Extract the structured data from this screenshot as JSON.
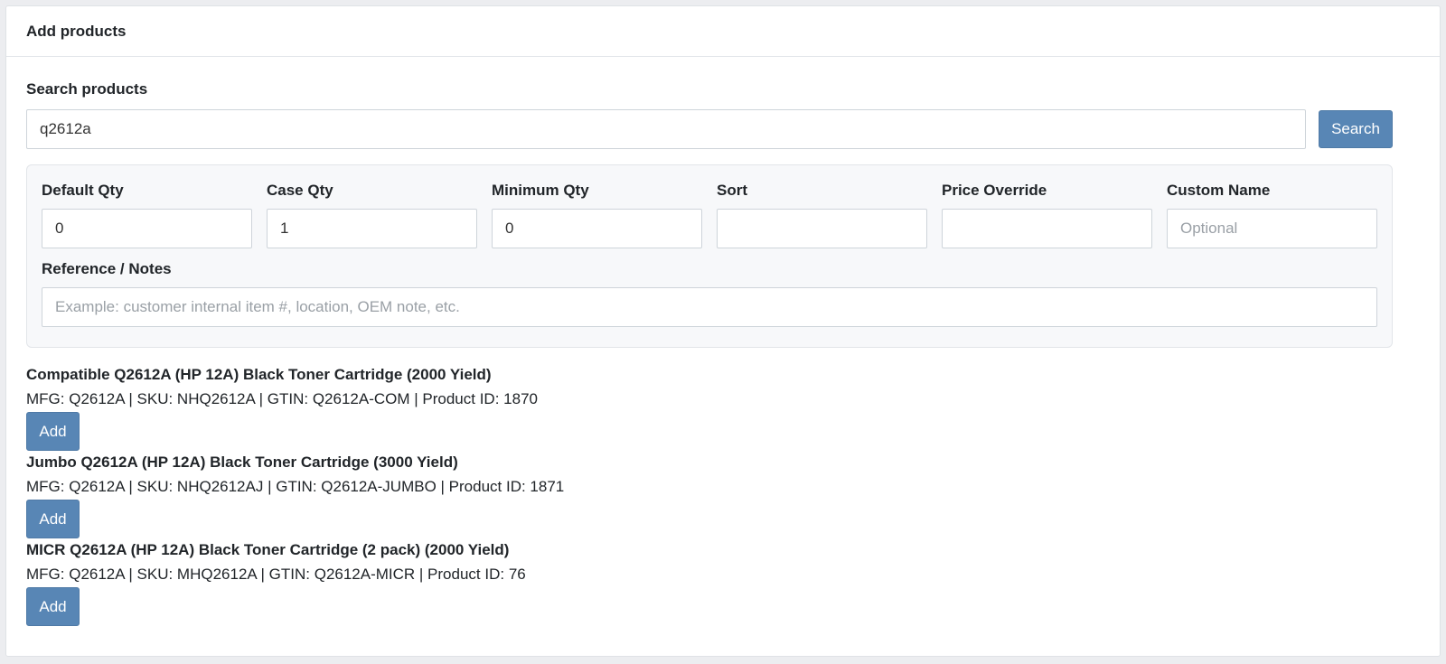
{
  "header": {
    "title": "Add products"
  },
  "search": {
    "label": "Search products",
    "value": "q2612a",
    "button_label": "Search"
  },
  "options": {
    "default_qty": {
      "label": "Default Qty",
      "value": "0",
      "placeholder": ""
    },
    "case_qty": {
      "label": "Case Qty",
      "value": "1",
      "placeholder": ""
    },
    "minimum_qty": {
      "label": "Minimum Qty",
      "value": "0",
      "placeholder": ""
    },
    "sort": {
      "label": "Sort",
      "value": "",
      "placeholder": ""
    },
    "price_override": {
      "label": "Price Override",
      "value": "",
      "placeholder": ""
    },
    "custom_name": {
      "label": "Custom Name",
      "value": "",
      "placeholder": "Optional"
    },
    "notes": {
      "label": "Reference / Notes",
      "value": "",
      "placeholder": "Example: customer internal item #, location, OEM note, etc."
    }
  },
  "results": [
    {
      "name": "Compatible Q2612A (HP 12A) Black Toner Cartridge (2000 Yield)",
      "meta": "MFG: Q2612A | SKU: NHQ2612A | GTIN: Q2612A-COM | Product ID: 1870",
      "add_label": "Add"
    },
    {
      "name": "Jumbo Q2612A (HP 12A) Black Toner Cartridge (3000 Yield)",
      "meta": "MFG: Q2612A | SKU: NHQ2612AJ | GTIN: Q2612A-JUMBO | Product ID: 1871",
      "add_label": "Add"
    },
    {
      "name": "MICR Q2612A (HP 12A) Black Toner Cartridge (2 pack) (2000 Yield)",
      "meta": "MFG: Q2612A | SKU: MHQ2612A | GTIN: Q2612A-MICR | Product ID: 76",
      "add_label": "Add"
    }
  ],
  "colors": {
    "primary_button": "#5886b5",
    "panel_background": "#f7f8fa",
    "page_background": "#ecedf0"
  }
}
